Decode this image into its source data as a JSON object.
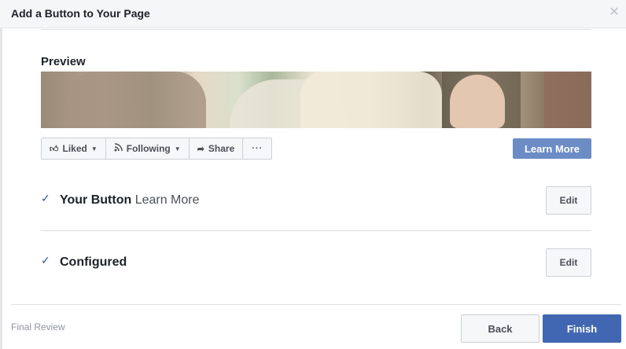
{
  "dialog": {
    "title": "Add a Button to Your Page",
    "close_icon": "close-icon"
  },
  "preview": {
    "label": "Preview",
    "action_bar": {
      "liked": {
        "label": "Liked",
        "icon": "thumbs-up-icon"
      },
      "following": {
        "label": "Following",
        "icon": "rss-icon"
      },
      "share": {
        "label": "Share",
        "icon": "share-arrow-icon"
      },
      "more": {
        "label": "···",
        "icon": "more-icon"
      }
    },
    "cta_button": "Learn More"
  },
  "steps": [
    {
      "title": "Your Button",
      "detail": "Learn More",
      "edit_label": "Edit",
      "icon": "check-icon"
    },
    {
      "title": "Configured",
      "detail": "",
      "edit_label": "Edit",
      "icon": "check-icon"
    }
  ],
  "footer": {
    "label": "Final Review",
    "back_label": "Back",
    "finish_label": "Finish"
  },
  "colors": {
    "primary": "#4267b2",
    "cta": "#6c8cc6",
    "check": "#365899"
  }
}
